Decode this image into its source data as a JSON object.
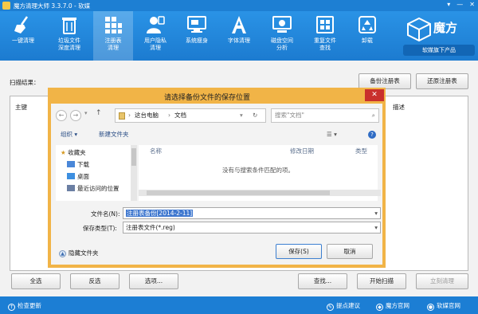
{
  "window": {
    "title": "魔方清理大师 3.3.7.0 - 软媒",
    "controls": [
      "▾",
      "—",
      "✕"
    ]
  },
  "toolbar": {
    "buttons": [
      {
        "label": "一键清理",
        "icon": "broom-icon"
      },
      {
        "label": "垃圾文件\n深度清理",
        "icon": "trash-files-icon"
      },
      {
        "label": "注册表\n清理",
        "icon": "registry-grid-icon"
      },
      {
        "label": "用户隐私\n清理",
        "icon": "privacy-user-icon"
      },
      {
        "label": "系统瘦身",
        "icon": "monitor-icon"
      },
      {
        "label": "字体清理",
        "icon": "font-a-icon"
      },
      {
        "label": "磁盘空间\n分析",
        "icon": "disk-analysis-icon"
      },
      {
        "label": "重复文件\n查找",
        "icon": "duplicate-files-icon"
      },
      {
        "label": "卸载",
        "icon": "recycle-icon"
      }
    ],
    "active_index": 2
  },
  "brand": {
    "name": "魔方",
    "tagline": "软媒旗下产品"
  },
  "main": {
    "scan_result_label": "扫描结果：",
    "backup_registry": "备份注册表",
    "restore_registry": "还原注册表",
    "list_headers": {
      "key": "主键",
      "desc": "描述"
    },
    "select_all": "全选",
    "invert_select": "反选",
    "options": "选项...",
    "find": "查找...",
    "start_scan": "开始扫描",
    "clean_now": "立刻清理"
  },
  "dialog": {
    "title": "请选择备份文件的保存位置",
    "close": "✕",
    "path": [
      "这台电脑",
      "文档"
    ],
    "search_placeholder": "搜索\"文档\"",
    "organize": "组织 ▾",
    "new_folder": "新建文件夹",
    "nav": {
      "favorites": "收藏夹",
      "downloads": "下载",
      "desktop": "桌面",
      "recent": "最近访问的位置"
    },
    "columns": {
      "name": "名称",
      "modified": "修改日期",
      "type": "类型"
    },
    "empty_message": "没有与搜索条件匹配的项。",
    "filename_label": "文件名(N):",
    "filename_value": "注册表备份[2014-2-11]",
    "filetype_label": "保存类型(T):",
    "filetype_value": "注册表文件(*.reg)",
    "hide_folders": "隐藏文件夹",
    "save": "保存(S)",
    "cancel": "取消"
  },
  "statusbar": {
    "update": "检查更新",
    "feedback": "提点建议",
    "site_mofang": "魔方官网",
    "site_ruanmei": "软媒官网"
  },
  "colors": {
    "titlebar": "#1d7fd3",
    "toolbar": "#2a93e6",
    "dialog_frame": "#f1b447",
    "close_red": "#c9302c",
    "status": "#1c7ed4"
  }
}
